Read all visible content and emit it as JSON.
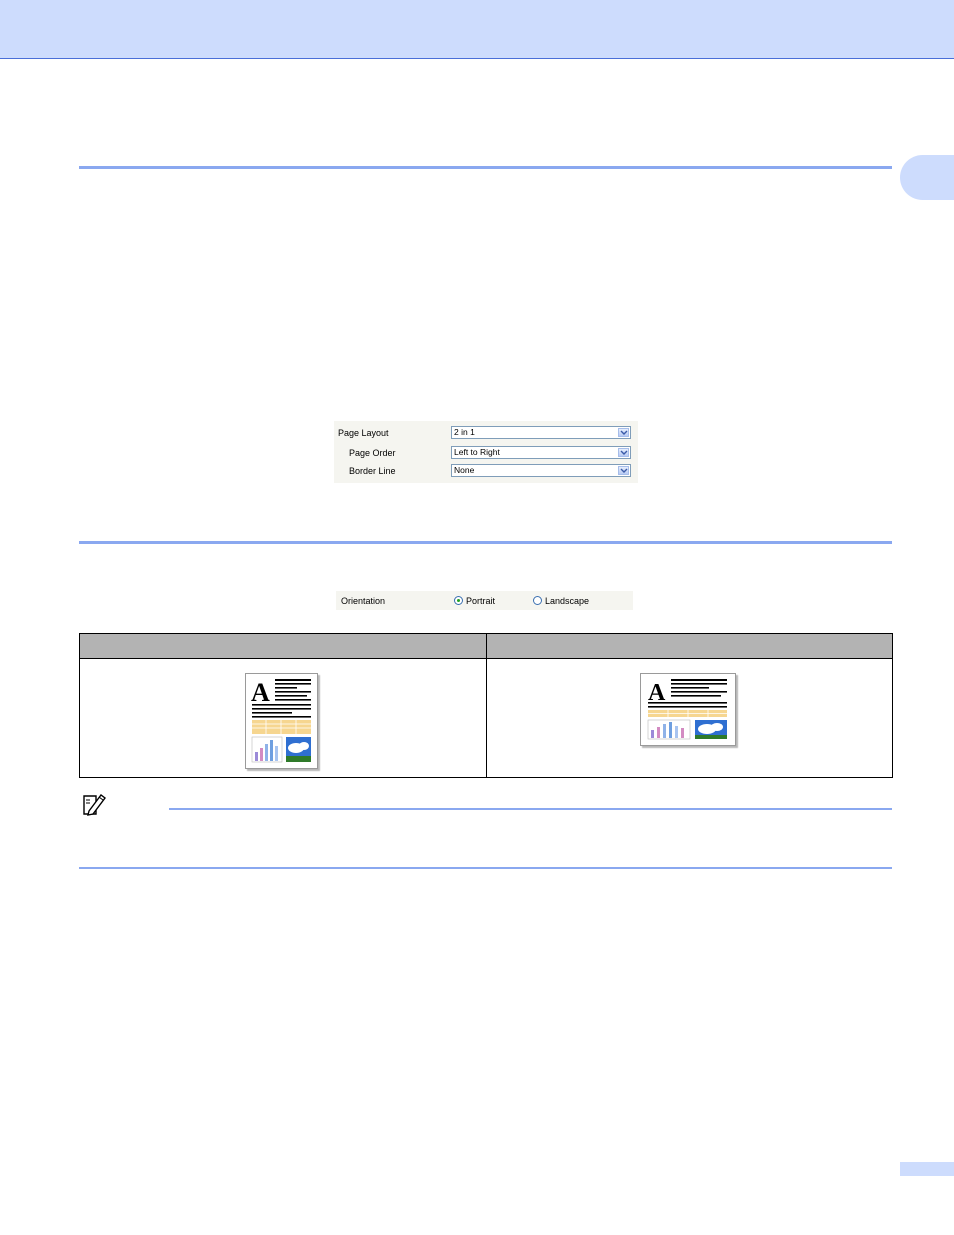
{
  "page_layout_panel": {
    "page_layout_label": "Page Layout",
    "page_layout_value": "2 in 1",
    "page_order_label": "Page Order",
    "page_order_value": "Left to Right",
    "border_line_label": "Border Line",
    "border_line_value": "None"
  },
  "orientation_panel": {
    "orientation_label": "Orientation",
    "portrait_label": "Portrait",
    "landscape_label": "Landscape",
    "selected": "Portrait"
  },
  "orientation_table": {
    "headers": [
      "",
      ""
    ]
  },
  "colors": {
    "header_band": "#cddcfd",
    "rule": "#8aa8f0",
    "table_header": "#b3b3b3"
  }
}
